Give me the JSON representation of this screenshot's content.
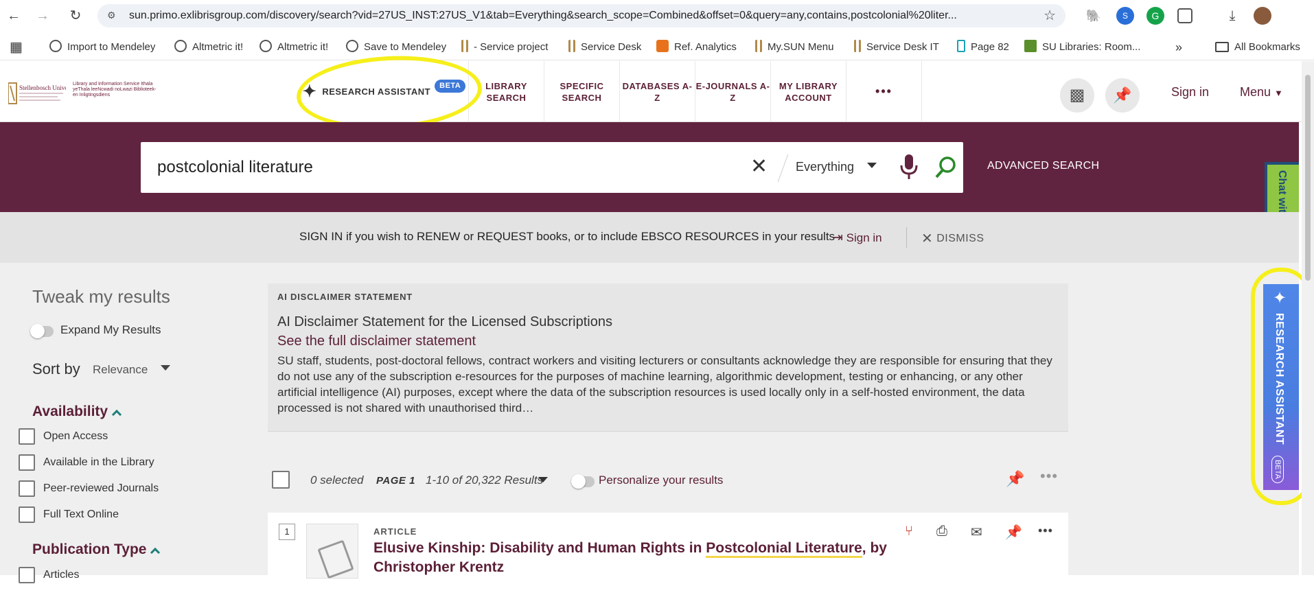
{
  "browser": {
    "url": "sun.primo.exlibrisgroup.com/discovery/search?vid=27US_INST:27US_V1&tab=Everything&search_scope=Combined&offset=0&query=any,contains,postcolonial%20liter...",
    "bookmarks": [
      {
        "label": "Import to Mendeley",
        "icon": "globe-icon"
      },
      {
        "label": "Altmetric it!",
        "icon": "globe-icon"
      },
      {
        "label": "Altmetric it!",
        "icon": "globe-icon"
      },
      {
        "label": "Save to Mendeley",
        "icon": "globe-icon"
      },
      {
        "label": "- Service project",
        "icon": "su-crest-icon"
      },
      {
        "label": "Service Desk",
        "icon": "su-crest-icon"
      },
      {
        "label": "Ref. Analytics",
        "icon": "question-badge-icon"
      },
      {
        "label": "My.SUN Menu",
        "icon": "su-crest-icon"
      },
      {
        "label": "Service Desk IT",
        "icon": "su-crest-icon"
      },
      {
        "label": "Page 82",
        "icon": "document-icon"
      },
      {
        "label": "SU Libraries: Room...",
        "icon": "grid-app-icon"
      }
    ],
    "all_bookmarks": "All Bookmarks",
    "overflow": "»"
  },
  "header": {
    "logo_text": "Stellenbosch University",
    "library_text": "Library and Information Service Ithala yeThala leeNcwadi noLwazi Biblioteek- en Inligtingsdiens",
    "nav": [
      {
        "label": "RESEARCH ASSISTANT",
        "badge": "BETA"
      },
      {
        "label": "LIBRARY SEARCH"
      },
      {
        "label": "SPECIFIC SEARCH"
      },
      {
        "label": "DATABASES A-Z"
      },
      {
        "label": "E-JOURNALS A-Z"
      },
      {
        "label": "MY LIBRARY ACCOUNT"
      },
      {
        "label": "•••"
      }
    ],
    "sign_in": "Sign in",
    "menu": "Menu"
  },
  "search": {
    "query": "postcolonial literature",
    "scope": "Everything",
    "advanced": "ADVANCED SEARCH"
  },
  "chat_tab": "Chat with Us",
  "side_assistant": {
    "label": "RESEARCH ASSISTANT",
    "badge": "BETA"
  },
  "signin_bar": {
    "message": "SIGN IN if you wish to RENEW or REQUEST books, or to include EBSCO RESOURCES in your results",
    "signin": "Sign in",
    "dismiss": "DISMISS"
  },
  "sidebar": {
    "title": "Tweak my results",
    "expand": "Expand My Results",
    "sort_label": "Sort by",
    "sort_value": "Relevance",
    "availability": {
      "heading": "Availability",
      "items": [
        "Open Access",
        "Available in the Library",
        "Peer-reviewed Journals",
        "Full Text Online"
      ]
    },
    "publication_type": {
      "heading": "Publication Type",
      "items": [
        "Articles"
      ]
    }
  },
  "disclaimer": {
    "tag": "AI DISCLAIMER STATEMENT",
    "title": "AI Disclaimer Statement for the Licensed Subscriptions",
    "link": "See the full disclaimer statement",
    "body": "SU staff, students, post-doctoral fellows, contract workers and visiting lecturers or consultants acknowledge they are responsible for ensuring that they do not use any of the subscription e-resources for the purposes of machine learning, algorithmic development, testing or enhancing, or any other artificial intelligence (AI) purposes, except where the data of the subscription resources is used locally only in a self-hosted environment, the data processed is not shared with unauthorised third…"
  },
  "results": {
    "selected": "0 selected",
    "page": "PAGE 1",
    "count": "1-10 of 20,322 Results",
    "personalize": "Personalize your results",
    "items": [
      {
        "number": "1",
        "type": "ARTICLE",
        "title_pre": "Elusive Kinship: Disability and Human Rights in ",
        "title_hl": "Postcolonial Literature",
        "title_post": ", by Christopher Krentz"
      }
    ]
  },
  "colors": {
    "maroon": "#612440",
    "link": "#5b1f35",
    "highlight": "#f6ef1b"
  }
}
